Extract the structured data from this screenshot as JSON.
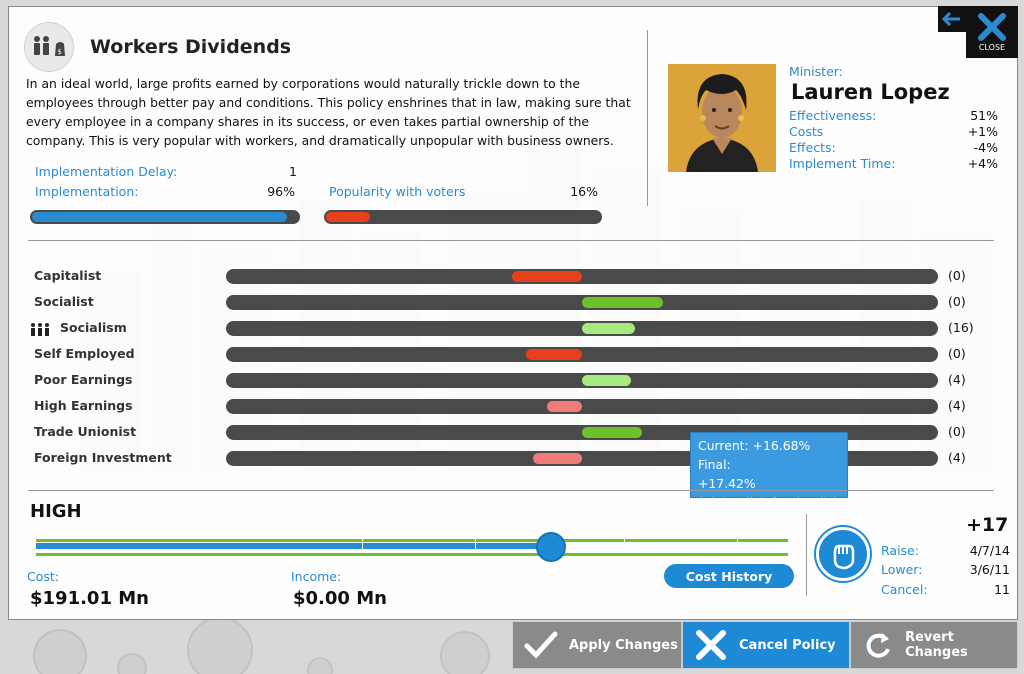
{
  "policy": {
    "title": "Workers Dividends",
    "description": "In an ideal world, large profits earned by corporations would naturally trickle down to the employees through better pay and conditions. This policy enshrines that in law, making sure that every employee in a company shares in its success, or even takes partial ownership of the company. This is very popular with workers, and dramatically unpopular with business owners.",
    "implementation_delay_label": "Implementation Delay:",
    "implementation_delay_value": "1",
    "implementation_label": "Implementation:",
    "implementation_value": "96%",
    "implementation_fraction": 0.96,
    "popularity_label": "Popularity with voters",
    "popularity_value": "16%",
    "popularity_fraction": 0.16
  },
  "minister": {
    "label": "Minister:",
    "name": "Lauren Lopez",
    "stats": [
      {
        "label": "Effectiveness:",
        "value": "51%"
      },
      {
        "label": "Costs",
        "value": "+1%"
      },
      {
        "label": "Effects:",
        "value": "-4%"
      },
      {
        "label": "Implement Time:",
        "value": "+4%"
      }
    ]
  },
  "window_controls": {
    "close_label": "CLOSE",
    "close_icon": "close-x-icon",
    "back_icon": "back-arrow-icon"
  },
  "effects": [
    {
      "label": "Capitalist",
      "count": "(0)",
      "value": -0.2,
      "color": "#e8401c",
      "icon": ""
    },
    {
      "label": "Socialist",
      "count": "(0)",
      "value": 0.23,
      "color": "#6cc12a",
      "icon": ""
    },
    {
      "label": "Socialism",
      "count": "(16)",
      "value": 0.15,
      "color": "#a7ea80",
      "icon": "people-group-icon"
    },
    {
      "label": "Self Employed",
      "count": "(0)",
      "value": -0.16,
      "color": "#e8401c",
      "icon": ""
    },
    {
      "label": "Poor Earnings",
      "count": "(4)",
      "value": 0.14,
      "color": "#a7ea80",
      "icon": ""
    },
    {
      "label": "High Earnings",
      "count": "(4)",
      "value": -0.1,
      "color": "#f07b7b",
      "icon": ""
    },
    {
      "label": "Trade Unionist",
      "count": "(0)",
      "value": 0.17,
      "color": "#6cc12a",
      "icon": ""
    },
    {
      "label": "Foreign Investment",
      "count": "(4)",
      "value": -0.14,
      "color": "#f07b7b",
      "icon": ""
    }
  ],
  "tooltip": {
    "line1": "Current: +16.68% Final:",
    "line2": "+17.42%",
    "line3": "(Right click for details)"
  },
  "slider": {
    "level_label": "HIGH",
    "position_fraction": 0.685
  },
  "finance": {
    "cost_label": "Cost:",
    "cost_value": "$191.01 Mn",
    "income_label": "Income:",
    "income_value": "$0.00 Mn",
    "cost_history_label": "Cost History"
  },
  "popularity_change": {
    "total": "+17",
    "icon": "raised-fist-icon",
    "rows": [
      {
        "label": "Raise:",
        "value": "4/7/14"
      },
      {
        "label": "Lower:",
        "value": "3/6/11"
      },
      {
        "label": "Cancel:",
        "value": "11"
      }
    ]
  },
  "actions": {
    "apply_label": "Apply Changes",
    "cancel_label": "Cancel Policy",
    "revert_label": "Revert Changes",
    "apply_color": "#8a8a8a",
    "cancel_color": "#1e8ad6",
    "revert_color": "#8a8a8a"
  }
}
